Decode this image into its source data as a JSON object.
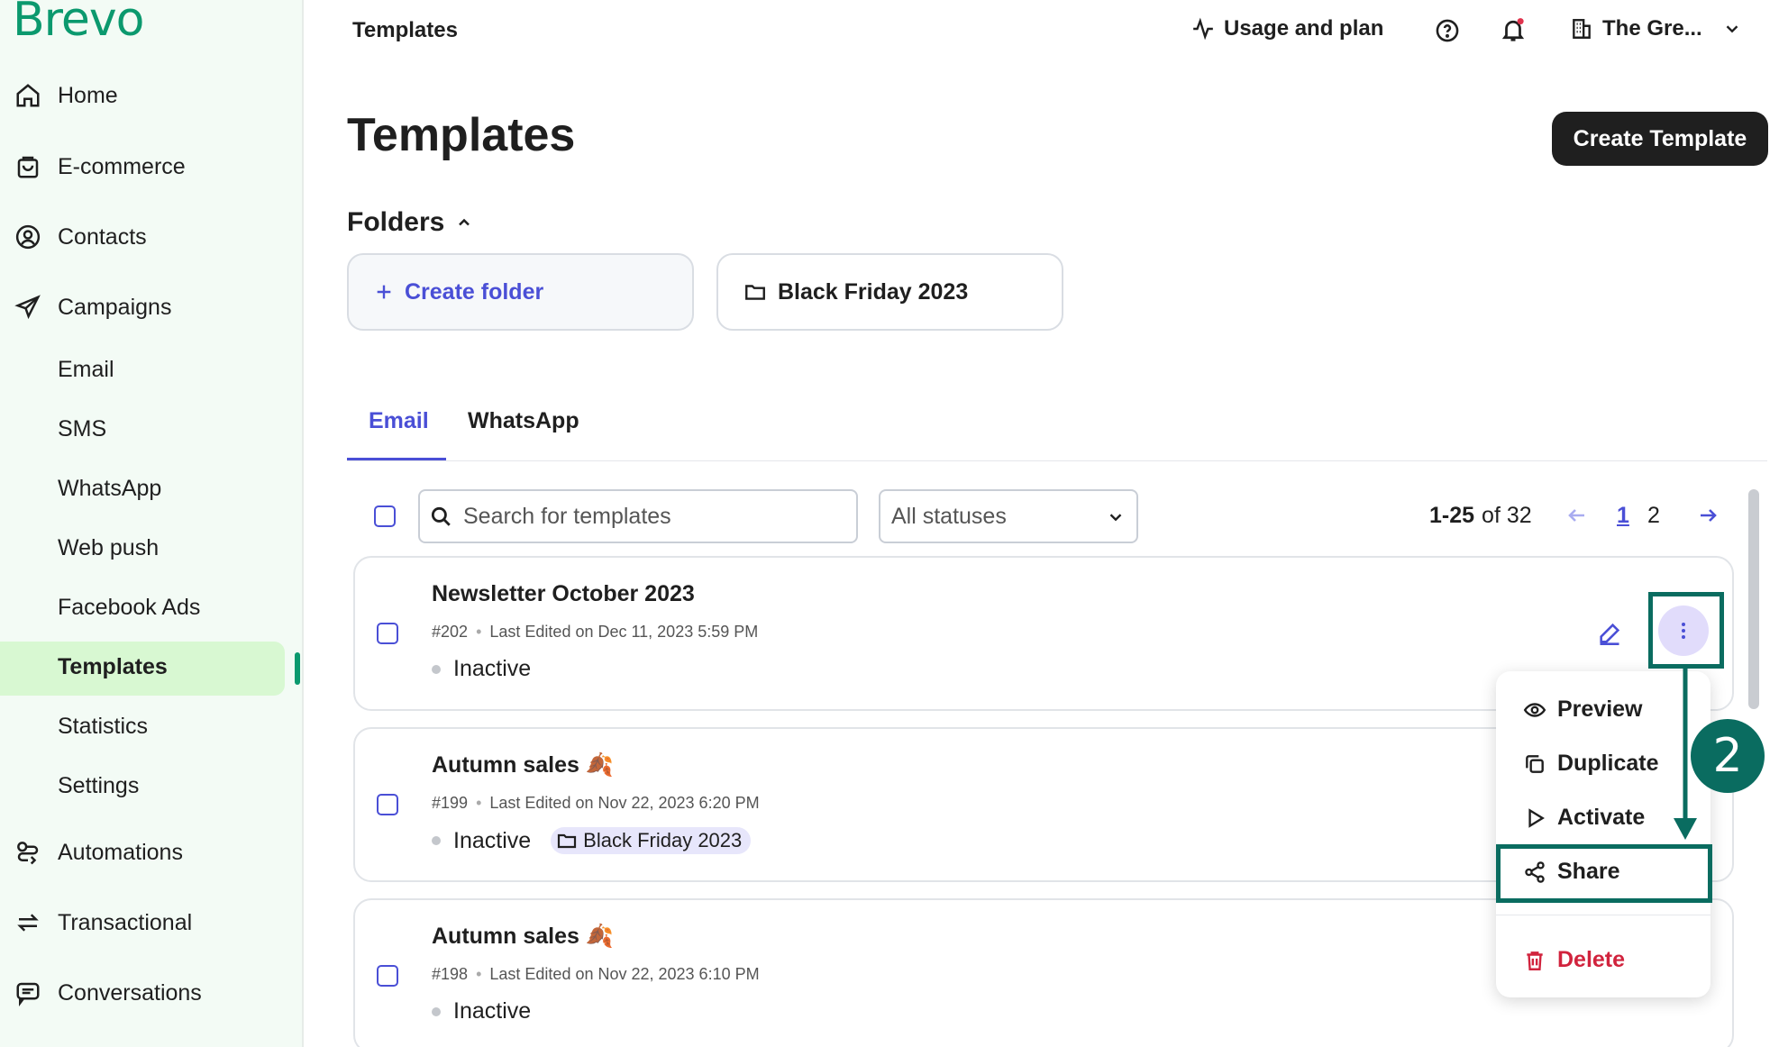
{
  "brand": "Brevo",
  "sidebar": {
    "items": [
      {
        "label": "Home",
        "icon": "home-icon"
      },
      {
        "label": "E-commerce",
        "icon": "shopping-bag-icon"
      },
      {
        "label": "Contacts",
        "icon": "contact-circle-icon"
      },
      {
        "label": "Campaigns",
        "icon": "send-icon"
      },
      {
        "label": "Automations",
        "icon": "automation-icon"
      },
      {
        "label": "Transactional",
        "icon": "transactional-icon"
      },
      {
        "label": "Conversations",
        "icon": "chat-icon"
      }
    ],
    "campaign_subitems": [
      "Email",
      "SMS",
      "WhatsApp",
      "Web push",
      "Facebook Ads",
      "Templates",
      "Statistics",
      "Settings"
    ],
    "active": "Templates"
  },
  "topbar": {
    "breadcrumb": "Templates",
    "usage": "Usage and plan",
    "account": "The Gre..."
  },
  "page": {
    "title": "Templates",
    "create_button": "Create Template",
    "folders_label": "Folders",
    "create_folder": "Create folder",
    "folder_name": "Black Friday 2023"
  },
  "tabs": [
    "Email",
    "WhatsApp"
  ],
  "filters": {
    "search_placeholder": "Search for templates",
    "status": "All statuses"
  },
  "pagination": {
    "range": "1-25",
    "of_text": "of 32",
    "pages": [
      "1",
      "2"
    ]
  },
  "templates": [
    {
      "title": "Newsletter October 2023",
      "id": "#202",
      "edited": "Last Edited on Dec 11, 2023 5:59 PM",
      "status": "Inactive",
      "folder": ""
    },
    {
      "title": "Autumn sales 🍂",
      "id": "#199",
      "edited": "Last Edited on Nov 22, 2023 6:20 PM",
      "status": "Inactive",
      "folder": "Black Friday 2023"
    },
    {
      "title": "Autumn sales 🍂",
      "id": "#198",
      "edited": "Last Edited on Nov 22, 2023 6:10 PM",
      "status": "Inactive",
      "folder": ""
    }
  ],
  "menu": {
    "items": [
      "Preview",
      "Duplicate",
      "Activate",
      "Share",
      "Delete"
    ]
  },
  "annotation": {
    "step": "2"
  },
  "colors": {
    "brand": "#0b996e",
    "accent": "#4a4fd6",
    "annotation": "#0a6c60",
    "danger": "#d1233d",
    "sidebar_bg": "#f3fbf5",
    "active_bg": "#d8f8d2"
  }
}
